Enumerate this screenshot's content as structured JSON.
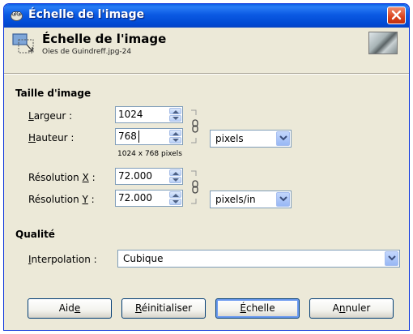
{
  "window": {
    "title": "Échelle de l'image",
    "colors": {
      "titlebar": "#0a5fe6",
      "dialog_bg": "#ece9d8",
      "close_button": "#d9431d"
    }
  },
  "header": {
    "title": "Échelle de l'image",
    "subtitle": "Oies de Guindreff.jpg-24"
  },
  "image_size": {
    "section_title": "Taille d'image",
    "width": {
      "label_mnemonic": "L",
      "label_rest": "argeur :",
      "value": "1024"
    },
    "height": {
      "label_mnemonic": "H",
      "label_rest": "auteur :",
      "value": "768"
    },
    "unit": "pixels",
    "size_note": "1024 x 768 pixels",
    "res_x": {
      "label_prefix": "Résolution ",
      "label_mnemonic": "X",
      "label_suffix": " :",
      "value": "72.000"
    },
    "res_y": {
      "label_prefix": "Résolution ",
      "label_mnemonic": "Y",
      "label_suffix": " :",
      "value": "72.000"
    },
    "res_unit": "pixels/in"
  },
  "quality": {
    "section_title": "Qualité",
    "interpolation": {
      "label_mnemonic": "I",
      "label_rest": "nterpolation :",
      "value": "Cubique"
    }
  },
  "buttons": {
    "help": {
      "pre": "Aid",
      "mnemonic": "e",
      "post": ""
    },
    "reset": {
      "pre": "",
      "mnemonic": "R",
      "post": "éinitialiser"
    },
    "scale": {
      "pre": "",
      "mnemonic": "É",
      "post": "chelle"
    },
    "cancel": {
      "pre": "A",
      "mnemonic": "n",
      "post": "nuler"
    }
  }
}
